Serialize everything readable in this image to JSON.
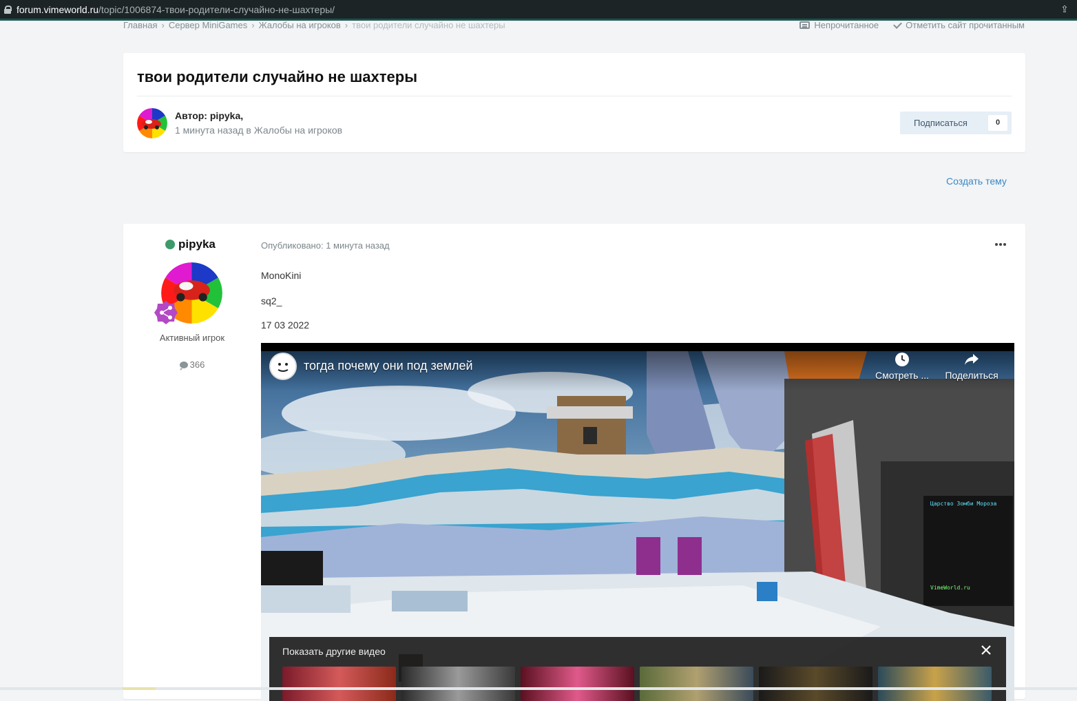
{
  "browser": {
    "url_host": "forum.vimeworld.ru",
    "url_path": "/topic/1006874-твои-родители-случайно-не-шахтеры/"
  },
  "breadcrumbs": [
    "Главная",
    "Сервер MiniGames",
    "Жалобы на игроков",
    "твои родители случайно не шахтеры"
  ],
  "top_actions": {
    "unread": "Непрочитанное",
    "mark_read": "Отметить сайт прочитанным"
  },
  "topic": {
    "title": "твои родители случайно не шахтеры",
    "author_prefix": "Автор:",
    "author": "pipyka,",
    "meta": "1 минута назад в Жалобы на игроков",
    "follow_label": "Подписаться",
    "follow_count": "0"
  },
  "create_topic": "Создать тему",
  "post": {
    "author": "pipyka",
    "rank": "Активный игрок",
    "post_count": "366",
    "posted": "Опубликовано: 1 минута назад",
    "lines": [
      "MonoKini",
      "sq2_",
      "17 03 2022"
    ],
    "video": {
      "title": "тогда почему они под землей",
      "watch_later": "Смотреть ...",
      "share": "Поделиться",
      "more_videos": "Показать другие видео"
    }
  },
  "colors": {
    "url_bar": "#1c2426",
    "link": "#3b88c4",
    "online": "#3e9a6a",
    "follow_bg": "#e6eef6"
  }
}
